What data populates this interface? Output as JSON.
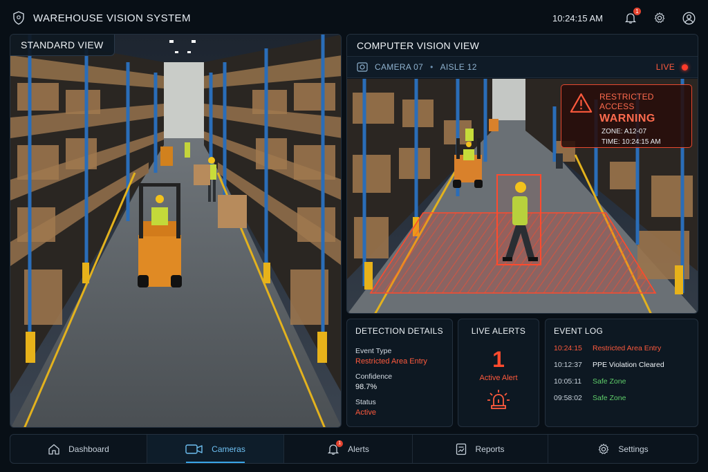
{
  "app": {
    "title": "WAREHOUSE VISION SYSTEM",
    "time": "10:24:15 AM",
    "notification_count": "1"
  },
  "icons": {
    "logo": "shield-icon",
    "notifications": "bell-icon",
    "settings": "gear-icon",
    "user": "user-circle-icon",
    "camera": "camera-icon",
    "siren": "siren-icon",
    "warning": "warning-triangle-icon"
  },
  "colors": {
    "accent": "#3aa5e8",
    "alert": "#ff5a3d",
    "ok": "#5fcf6a",
    "background": "#080f16"
  },
  "standard_view": {
    "label": "STANDARD VIEW"
  },
  "cv_view": {
    "label": "COMPUTER VISION VIEW",
    "camera": "CAMERA 07",
    "separator": "•",
    "aisle": "AISLE 12",
    "live": "LIVE",
    "warning": {
      "title": "RESTRICTED ACCESS",
      "headline": "WARNING",
      "zone": "ZONE: A12-07",
      "time": "TIME: 10:24:15 AM"
    }
  },
  "detection": {
    "title": "DETECTION DETAILS",
    "event_type_label": "Event Type",
    "event_type_value": "Restricted Area Entry",
    "confidence_label": "Confidence",
    "confidence_value": "98.7%",
    "status_label": "Status",
    "status_value": "Active"
  },
  "live_alerts": {
    "title": "LIVE ALERTS",
    "count": "1",
    "subtitle": "Active Alert"
  },
  "event_log": {
    "title": "EVENT LOG",
    "rows": [
      {
        "time": "10:24:15",
        "event": "Restricted Area Entry",
        "tone": "alert"
      },
      {
        "time": "10:12:37",
        "event": "PPE Violation Cleared",
        "tone": "neutral"
      },
      {
        "time": "10:05:11",
        "event": "Safe Zone",
        "tone": "ok"
      },
      {
        "time": "09:58:02",
        "event": "Safe Zone",
        "tone": "ok"
      }
    ]
  },
  "nav": {
    "items": [
      {
        "label": "Dashboard",
        "icon": "home-icon"
      },
      {
        "label": "Cameras",
        "icon": "video-camera-icon",
        "active": true
      },
      {
        "label": "Alerts",
        "icon": "bell-icon",
        "badge": "1"
      },
      {
        "label": "Reports",
        "icon": "report-icon"
      },
      {
        "label": "Settings",
        "icon": "gear-icon"
      }
    ]
  }
}
